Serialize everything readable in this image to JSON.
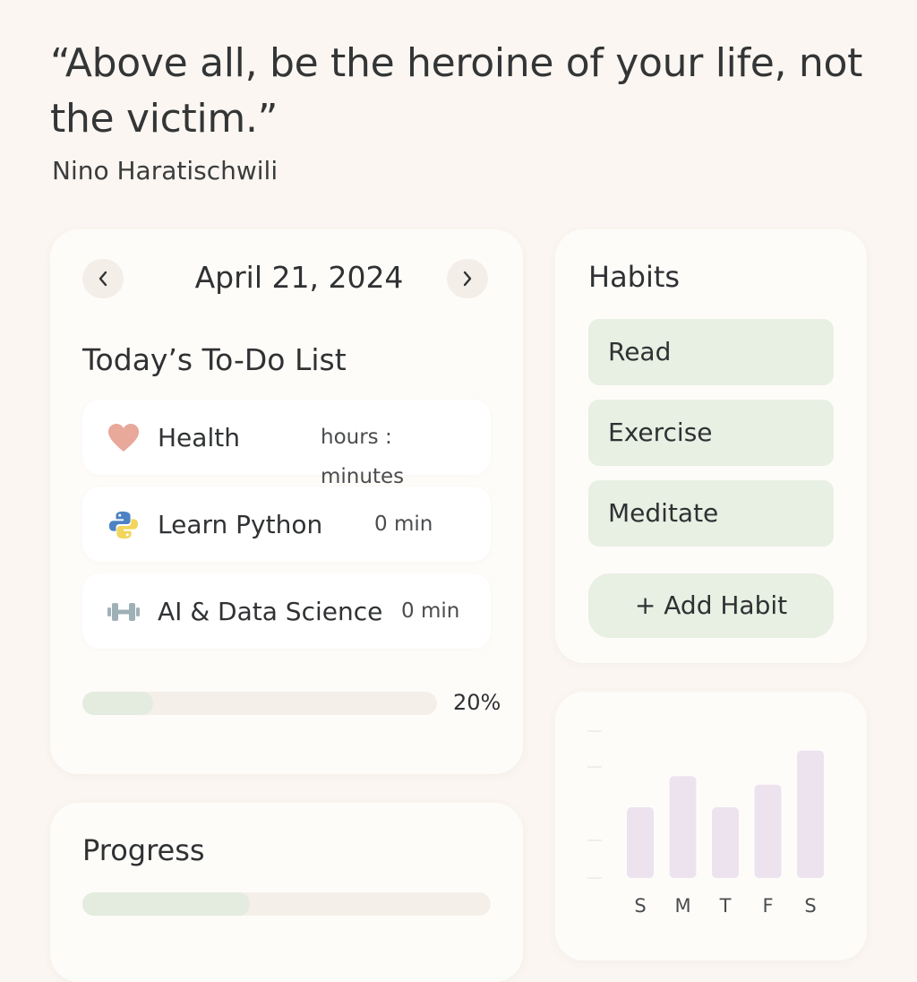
{
  "quote": {
    "text": "“Above all, be the heroine of your life, not the victim.”",
    "author": "Nino Haratischwili"
  },
  "todo_card": {
    "date": "April 21, 2024",
    "prev_icon": "chevron-left-icon",
    "next_icon": "chevron-right-icon",
    "title": "Today’s To-Do List",
    "items": [
      {
        "icon": "heart-icon",
        "label": "Health",
        "time": "hours : minutes"
      },
      {
        "icon": "python-icon",
        "label": "Learn Python",
        "time": "0 min"
      },
      {
        "icon": "dumbbell-icon",
        "label": "AI & Data Science",
        "time": "0 min"
      }
    ],
    "progress_percent": 20,
    "progress_label": "20%"
  },
  "habits": {
    "title": "Habits",
    "items": [
      "Read",
      "Exercise",
      "Meditate"
    ],
    "add_label": "+ Add Habit"
  },
  "progress_card": {
    "title": "Progress",
    "progress_fraction": 0.41
  },
  "chart_data": {
    "type": "bar",
    "categories": [
      "S",
      "M",
      "T",
      "F",
      "S"
    ],
    "values": [
      2.5,
      3.6,
      2.5,
      3.3,
      4.5
    ],
    "ylim": [
      0,
      5
    ],
    "grid": false,
    "bar_color": "#ede3ef"
  },
  "colors": {
    "background": "#fbf6f1",
    "card": "#fefcf9",
    "habit_fill": "#e8efe3",
    "progress_fill": "#e4ebdf",
    "heart": "#e8a89a",
    "python_blue": "#4c82c3",
    "python_yellow": "#f2d55c",
    "dumbbell": "#9fb1b6"
  }
}
